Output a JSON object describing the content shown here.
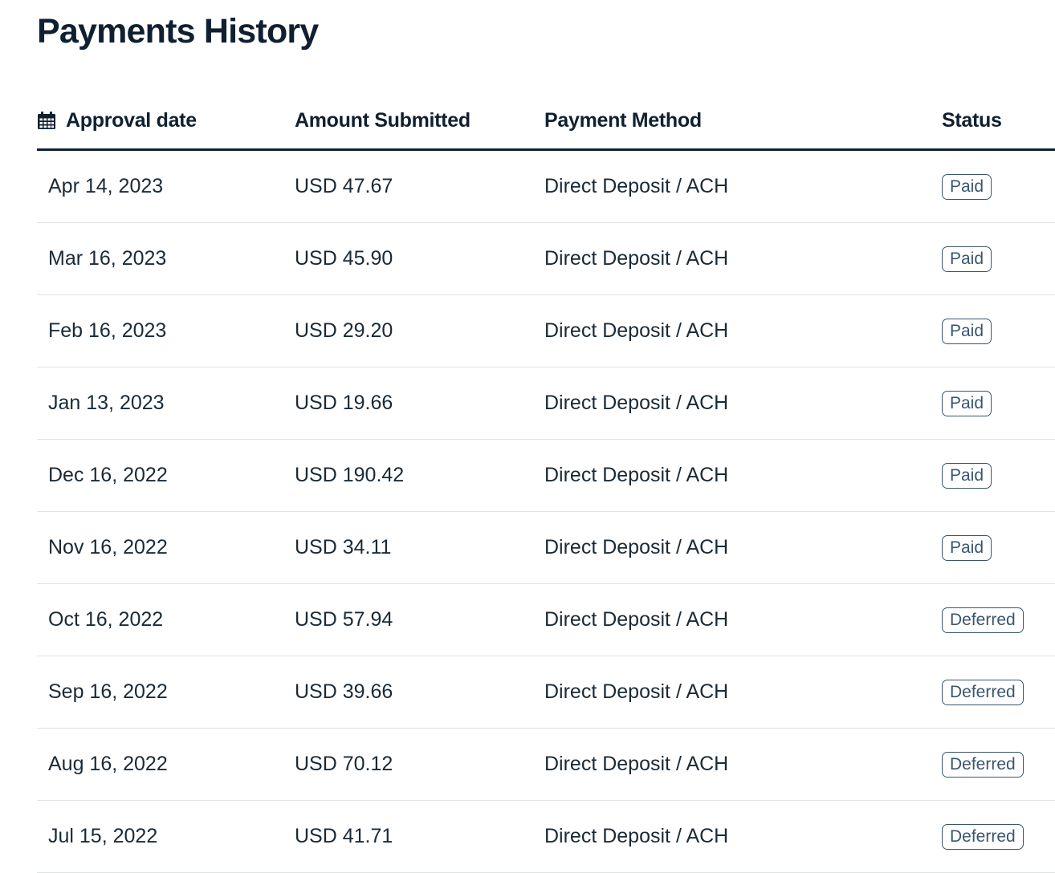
{
  "page": {
    "title": "Payments History"
  },
  "table": {
    "headers": {
      "date": "Approval date",
      "amount": "Amount Submitted",
      "method": "Payment Method",
      "status": "Status"
    },
    "date_icon": "calendar-icon",
    "rows": [
      {
        "date": "Apr 14, 2023",
        "amount": "USD 47.67",
        "method": "Direct Deposit / ACH",
        "status": "Paid"
      },
      {
        "date": "Mar 16, 2023",
        "amount": "USD 45.90",
        "method": "Direct Deposit / ACH",
        "status": "Paid"
      },
      {
        "date": "Feb 16, 2023",
        "amount": "USD 29.20",
        "method": "Direct Deposit / ACH",
        "status": "Paid"
      },
      {
        "date": "Jan 13, 2023",
        "amount": "USD 19.66",
        "method": "Direct Deposit / ACH",
        "status": "Paid"
      },
      {
        "date": "Dec 16, 2022",
        "amount": "USD 190.42",
        "method": "Direct Deposit / ACH",
        "status": "Paid"
      },
      {
        "date": "Nov 16, 2022",
        "amount": "USD 34.11",
        "method": "Direct Deposit / ACH",
        "status": "Paid"
      },
      {
        "date": "Oct 16, 2022",
        "amount": "USD 57.94",
        "method": "Direct Deposit / ACH",
        "status": "Deferred"
      },
      {
        "date": "Sep 16, 2022",
        "amount": "USD 39.66",
        "method": "Direct Deposit / ACH",
        "status": "Deferred"
      },
      {
        "date": "Aug 16, 2022",
        "amount": "USD 70.12",
        "method": "Direct Deposit / ACH",
        "status": "Deferred"
      },
      {
        "date": "Jul 15, 2022",
        "amount": "USD 41.71",
        "method": "Direct Deposit / ACH",
        "status": "Deferred"
      }
    ]
  },
  "colors": {
    "heading": "#102030",
    "text": "#1a2a36",
    "badge": "#3a5570",
    "divider": "#dfe3e6"
  }
}
